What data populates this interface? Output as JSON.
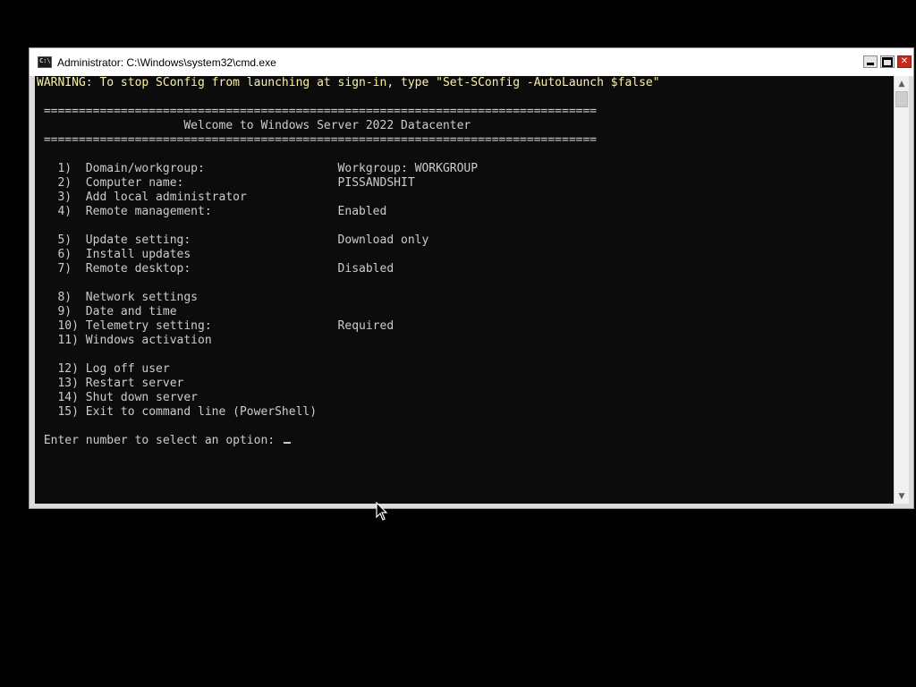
{
  "window": {
    "title": "Administrator: C:\\Windows\\system32\\cmd.exe",
    "icon": "cmd-icon",
    "controls": [
      "minimize-icon",
      "maximize-icon",
      "close-icon"
    ]
  },
  "console": {
    "lines": [
      "WARNING: To stop SConfig from launching at sign-in, type \"Set-SConfig -AutoLaunch $false\"",
      "",
      " ===============================================================================",
      "                     Welcome to Windows Server 2022 Datacenter",
      " ===============================================================================",
      "",
      "   1)  Domain/workgroup:                   Workgroup: WORKGROUP",
      "   2)  Computer name:                      PISSANDSHIT",
      "   3)  Add local administrator",
      "   4)  Remote management:                  Enabled",
      "",
      "   5)  Update setting:                     Download only",
      "   6)  Install updates",
      "   7)  Remote desktop:                     Disabled",
      "",
      "   8)  Network settings",
      "   9)  Date and time",
      "   10) Telemetry setting:                  Required",
      "   11) Windows activation",
      "",
      "   12) Log off user",
      "   13) Restart server",
      "   14) Shut down server",
      "   15) Exit to command line (PowerShell)",
      "",
      " Enter number to select an option: "
    ]
  },
  "colors": {
    "console_bg": "#0c0c0c",
    "console_fg": "#cccccc",
    "warning_fg": "#f9f1a5"
  }
}
